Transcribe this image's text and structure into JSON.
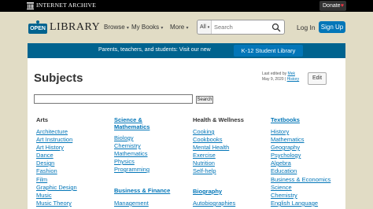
{
  "archive_bar": {
    "title": "INTERNET ARCHIVE",
    "donate": "Donate",
    "heart": "♥"
  },
  "header": {
    "logo_open": "OPEN",
    "logo_library": "LIBRARY",
    "nav": [
      {
        "label": "Browse"
      },
      {
        "label": "My Books"
      },
      {
        "label": "More"
      }
    ],
    "search_scope": "All",
    "search_placeholder": "Search",
    "login": "Log In",
    "signup": "Sign Up"
  },
  "banner": {
    "text": "Parents, teachers, and students: Visit our new",
    "button": "K-12 Student Library"
  },
  "page": {
    "title": "Subjects",
    "edit_meta": {
      "line1_prefix": "Last edited by",
      "editor": "Mek",
      "date": "May 9, 2020",
      "sep": "|",
      "history": "History"
    },
    "edit_button": "Edit",
    "search_button": "Search"
  },
  "columns": [
    {
      "heading": "Arts",
      "heading_link": false,
      "items": [
        "Architecture",
        "Art Instruction",
        "Art History",
        "Dance",
        "Design",
        "Fashion",
        "Film",
        "Graphic Design",
        "Music",
        "Music Theory"
      ]
    },
    {
      "heading": "Science & Mathematics",
      "heading_link": true,
      "items": [
        "Biology",
        "Chemistry",
        "Mathematics",
        "Physics",
        "Programming"
      ],
      "heading2": "Business & Finance",
      "items2": [
        "Management"
      ]
    },
    {
      "heading": "Health & Wellness",
      "heading_link": false,
      "items": [
        "Cooking",
        "Cookbooks",
        "Mental Health",
        "Exercise",
        "Nutrition",
        "Self-help"
      ],
      "heading2": "Biography",
      "items2": [
        "Autobiographies"
      ]
    },
    {
      "heading": "Textbooks",
      "heading_link": true,
      "items": [
        "History",
        "Mathematics",
        "Geography",
        "Psychology",
        "Algebra",
        "Education",
        "Business & Economics",
        "Science",
        "Chemistry",
        "English Language"
      ]
    }
  ]
}
